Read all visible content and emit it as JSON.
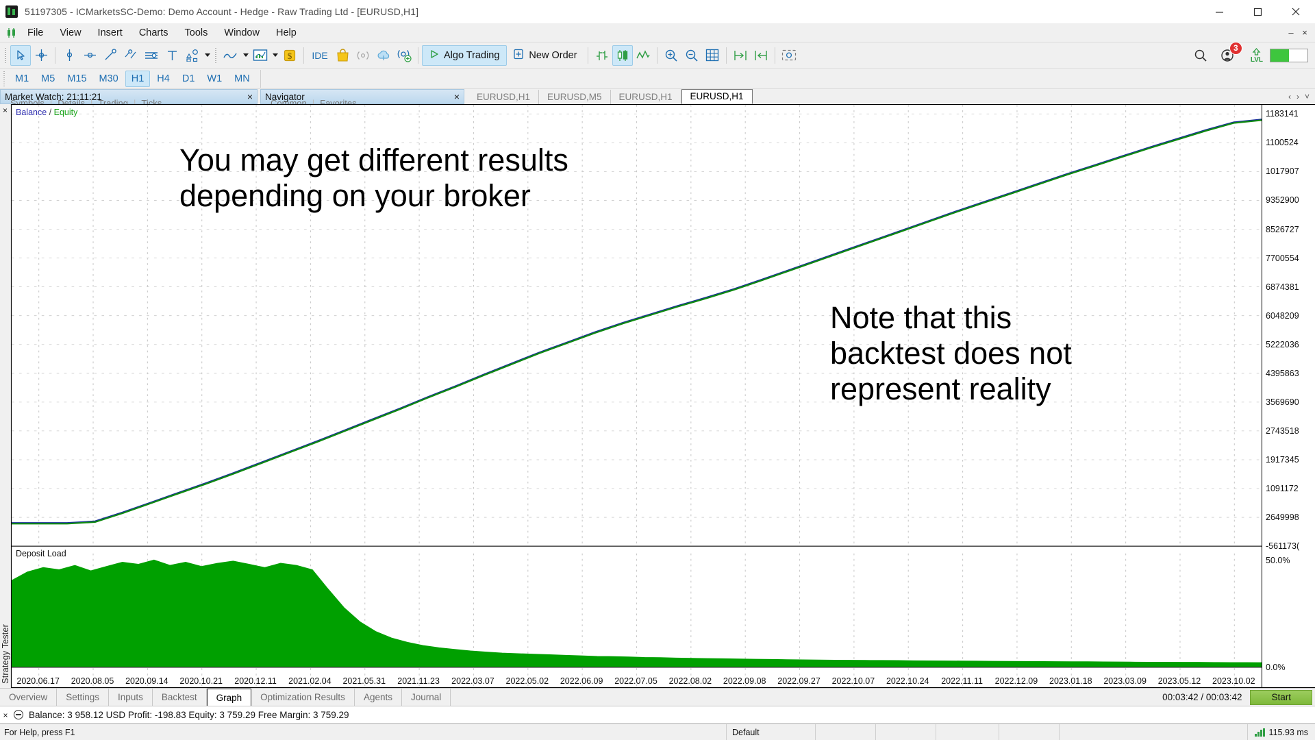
{
  "window": {
    "title": "51197305 - ICMarketsSC-Demo: Demo Account - Hedge - Raw Trading Ltd - [EURUSD,H1]",
    "minimize": "minimize-icon",
    "maximize": "maximize-icon",
    "close": "close-icon"
  },
  "menu": {
    "items": [
      "File",
      "View",
      "Insert",
      "Charts",
      "Tools",
      "Window",
      "Help"
    ],
    "right_minimize": "–",
    "right_close": "×"
  },
  "toolbar": {
    "group1": [
      {
        "name": "cursor-tool",
        "icon": "arrow-cursor-icon",
        "active": true
      },
      {
        "name": "crosshair-tool",
        "icon": "crosshair-icon",
        "active": false
      }
    ],
    "group2": [
      {
        "name": "vertical-line-tool",
        "icon": "vertical-line-icon",
        "active": false
      },
      {
        "name": "horizontal-line-tool",
        "icon": "horizontal-line-icon",
        "active": false
      },
      {
        "name": "trendline-tool",
        "icon": "trendline-icon",
        "active": false
      },
      {
        "name": "polyline-tool",
        "icon": "polyline-icon",
        "active": false
      },
      {
        "name": "equidistant-channel-tool",
        "icon": "channel-icon",
        "active": false
      },
      {
        "name": "text-tool",
        "icon": "text-t-icon",
        "active": false
      },
      {
        "name": "shapes-tool",
        "icon": "shapes-icon",
        "active": false
      }
    ],
    "group3": [
      {
        "name": "chart-type-line",
        "icon": "line-chart-icon"
      },
      {
        "name": "chart-templates",
        "icon": "template-chart-icon"
      },
      {
        "name": "price-currency",
        "icon": "dollar-tag-icon"
      }
    ],
    "ide_label": "IDE",
    "market_icon": "shopping-bag-icon",
    "signals_icon": "broadcast-icon",
    "vps_icon": "cloud-icon",
    "community_icon": "community-add-icon",
    "algo_trading": {
      "label": "Algo Trading",
      "icon": "play-triangle-icon",
      "active": true
    },
    "new_order": {
      "label": "New Order",
      "icon": "plus-box-icon"
    },
    "group5": [
      {
        "name": "bar-chart-button",
        "icon": "bar-chart-icon",
        "active": false
      },
      {
        "name": "candlestick-chart-button",
        "icon": "candlestick-icon",
        "active": true
      },
      {
        "name": "line-chart-button",
        "icon": "zigzag-line-icon",
        "active": false
      }
    ],
    "group6": [
      {
        "name": "zoom-in-button",
        "icon": "magnifier-plus-icon"
      },
      {
        "name": "zoom-out-button",
        "icon": "magnifier-minus-icon"
      },
      {
        "name": "grid-button",
        "icon": "grid-icon"
      }
    ],
    "group7": [
      {
        "name": "shift-end-button",
        "icon": "shift-right-icon"
      },
      {
        "name": "auto-scroll-button",
        "icon": "shift-left-icon"
      },
      {
        "name": "screenshot-button",
        "icon": "screenshot-icon"
      }
    ],
    "right": {
      "search_icon": "search-icon",
      "account_icon": "account-icon",
      "notification_count": "3",
      "lvl_label": "LVL",
      "lvl_arrow": "up-arrow-icon",
      "battery_icon": "battery-icon"
    }
  },
  "timeframes": {
    "items": [
      "M1",
      "M5",
      "M15",
      "M30",
      "H1",
      "H4",
      "D1",
      "W1",
      "MN"
    ],
    "active": "H1"
  },
  "panels": {
    "market_watch": {
      "title": "Market Watch: 21:11:21",
      "close": "×",
      "subtabs": [
        "Symbols",
        "Details",
        "Trading",
        "Ticks"
      ]
    },
    "navigator": {
      "title": "Navigator",
      "close": "×",
      "subtabs": [
        "Common",
        "Favorites"
      ]
    }
  },
  "chart_tabs": {
    "items": [
      {
        "label": "EURUSD,H1",
        "active": false
      },
      {
        "label": "EURUSD,M5",
        "active": false
      },
      {
        "label": "EURUSD,H1",
        "active": false
      },
      {
        "label": "EURUSD,H1",
        "active": true
      }
    ],
    "nav_left": "‹",
    "nav_right": "›",
    "nav_down": "˅"
  },
  "strategy_tester": {
    "vertical_label": "Strategy Tester",
    "close_icon": "close-icon",
    "tabs": [
      {
        "label": "Overview",
        "active": false
      },
      {
        "label": "Settings",
        "active": false
      },
      {
        "label": "Inputs",
        "active": false
      },
      {
        "label": "Backtest",
        "active": false
      },
      {
        "label": "Graph",
        "active": true
      },
      {
        "label": "Optimization Results",
        "active": false
      },
      {
        "label": "Agents",
        "active": false
      },
      {
        "label": "Journal",
        "active": false
      }
    ],
    "timer": "00:03:42 / 00:03:42",
    "start_button": "Start"
  },
  "terminal": {
    "close_icon": "×",
    "collapse_icon": "minus-circle-icon",
    "summary": "Balance: 3 958.12 USD  Profit: -198.83  Equity: 3 759.29  Free Margin: 3 759.29"
  },
  "statusbar": {
    "help": "For Help, press F1",
    "profile": "Default",
    "cells": [
      "",
      "",
      "",
      "",
      "",
      ""
    ],
    "ping": "115.93 ms",
    "ping_icon": "signal-bars-icon"
  },
  "chart_data": {
    "type": "line",
    "title": "Balance / Equity",
    "legend": {
      "balance": "Balance",
      "separator": "/",
      "equity": "Equity"
    },
    "legend_position": "top-left",
    "grid": true,
    "xlabel": "",
    "ylabel": "",
    "annotations": [
      {
        "text_line1": "You may get different results",
        "text_line2": "depending on your broker"
      },
      {
        "text_line1": "Note that this",
        "text_line2": "backtest does not",
        "text_line3": "represent reality"
      }
    ],
    "y_ticks": [
      "1183141",
      "1100524",
      "1017907",
      "9352900",
      "8526727",
      "7700554",
      "6874381",
      "6048209",
      "5222036",
      "4395863",
      "3569690",
      "2743518",
      "1917345",
      "1091172",
      "2649998",
      "-561173("
    ],
    "x_ticks": [
      "2020.06.17",
      "2020.08.05",
      "2020.09.14",
      "2020.10.21",
      "2020.12.11",
      "2021.02.04",
      "2021.05.31",
      "2021.11.23",
      "2022.03.07",
      "2022.05.02",
      "2022.06.09",
      "2022.07.05",
      "2022.08.02",
      "2022.09.08",
      "2022.09.27",
      "2022.10.07",
      "2022.10.24",
      "2022.11.11",
      "2022.12.09",
      "2023.01.18",
      "2023.03.09",
      "2023.05.12",
      "2023.10.02"
    ],
    "series": [
      {
        "name": "Balance",
        "color": "#1a2f9c",
        "values": [
          0.008,
          0.008,
          0.008,
          0.012,
          0.034,
          0.058,
          0.082,
          0.106,
          0.131,
          0.157,
          0.183,
          0.209,
          0.236,
          0.263,
          0.29,
          0.318,
          0.345,
          0.373,
          0.4,
          0.427,
          0.452,
          0.477,
          0.5,
          0.521,
          0.542,
          0.562,
          0.583,
          0.606,
          0.63,
          0.654,
          0.678,
          0.702,
          0.726,
          0.75,
          0.774,
          0.797,
          0.82,
          0.843,
          0.866,
          0.888,
          0.91,
          0.932,
          0.953,
          0.974,
          0.993,
          1.0
        ]
      },
      {
        "name": "Equity",
        "color": "#0f8a0f",
        "values": [
          0.006,
          0.006,
          0.006,
          0.01,
          0.032,
          0.056,
          0.08,
          0.104,
          0.129,
          0.155,
          0.181,
          0.207,
          0.234,
          0.261,
          0.288,
          0.316,
          0.343,
          0.371,
          0.398,
          0.425,
          0.45,
          0.475,
          0.498,
          0.519,
          0.54,
          0.56,
          0.581,
          0.604,
          0.628,
          0.652,
          0.676,
          0.7,
          0.724,
          0.748,
          0.772,
          0.795,
          0.818,
          0.841,
          0.864,
          0.886,
          0.908,
          0.93,
          0.951,
          0.972,
          0.991,
          0.998
        ]
      }
    ],
    "deposit_load": {
      "label": "Deposit Load",
      "color": "#00a000",
      "y_ticks": [
        "50.0%",
        "0.0%"
      ],
      "values": [
        0.8,
        0.88,
        0.92,
        0.9,
        0.94,
        0.89,
        0.93,
        0.97,
        0.95,
        0.99,
        0.94,
        0.97,
        0.93,
        0.96,
        0.98,
        0.95,
        0.92,
        0.96,
        0.94,
        0.9,
        0.72,
        0.55,
        0.42,
        0.33,
        0.27,
        0.23,
        0.2,
        0.18,
        0.165,
        0.15,
        0.14,
        0.13,
        0.125,
        0.12,
        0.115,
        0.11,
        0.105,
        0.1,
        0.098,
        0.095,
        0.09,
        0.088,
        0.085,
        0.082,
        0.08,
        0.078,
        0.076,
        0.074,
        0.072,
        0.07,
        0.068,
        0.066,
        0.065,
        0.064,
        0.063,
        0.062,
        0.061,
        0.06,
        0.059,
        0.058,
        0.057,
        0.056,
        0.055,
        0.054,
        0.053,
        0.052,
        0.051,
        0.05,
        0.05,
        0.049,
        0.048,
        0.047,
        0.046,
        0.046,
        0.045,
        0.045,
        0.044,
        0.043,
        0.043,
        0.042
      ]
    }
  }
}
